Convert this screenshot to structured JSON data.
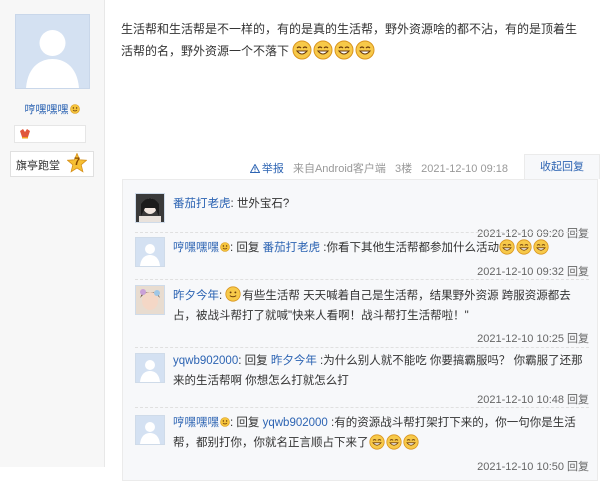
{
  "user": {
    "name": "哼嘿嘿嘿",
    "level_title": "旗亭跑堂",
    "level": "7"
  },
  "post": {
    "content_text": "生活帮和生活帮是不一样的，有的是真的生活帮，野外资源啥的都不沾，有的是顶着生活帮的名，野外资源一个不落下",
    "emoji_count": 4
  },
  "meta": {
    "report": "举报",
    "source": "来自Android客户端",
    "floor": "3楼",
    "time": "2021-12-10 09:18",
    "fold": "收起回复"
  },
  "replies": [
    {
      "user": "番茄打老虎",
      "text": ": 世外宝石?",
      "time": "2021-12-10 09:20",
      "reply_label": "回复"
    },
    {
      "user": "哼嘿嘿嘿",
      "reply_word": ": 回复",
      "target": "番茄打老虎",
      "text": " :你看下其他生活帮都参加什么活动",
      "time": "2021-12-10 09:32",
      "reply_label": "回复"
    },
    {
      "user": "昨夕今年",
      "text": "有些生活帮 天天喊着自己是生活帮，结果野外资源 跨服资源都去占，被战斗帮打了就喊\"快来人看啊！战斗帮打生活帮啦！\"",
      "time": "2021-12-10 10:25",
      "reply_label": "回复"
    },
    {
      "user": "yqwb902000",
      "reply_word": ": 回复",
      "target": "昨夕今年",
      "text": " :为什么别人就不能吃 你要搞霸服吗？ 你霸服了还那来的生活帮啊 你想怎么打就怎么打",
      "time": "2021-12-10 10:48",
      "reply_label": "回复"
    },
    {
      "user": "哼嘿嘿嘿",
      "reply_word": ": 回复",
      "target": "yqwb902000",
      "text": " :有的资源战斗帮打架打下来的，你一句你是生活帮，都别打你，你就名正言顺占下来了",
      "time": "2021-12-10 10:50",
      "reply_label": "回复"
    }
  ]
}
